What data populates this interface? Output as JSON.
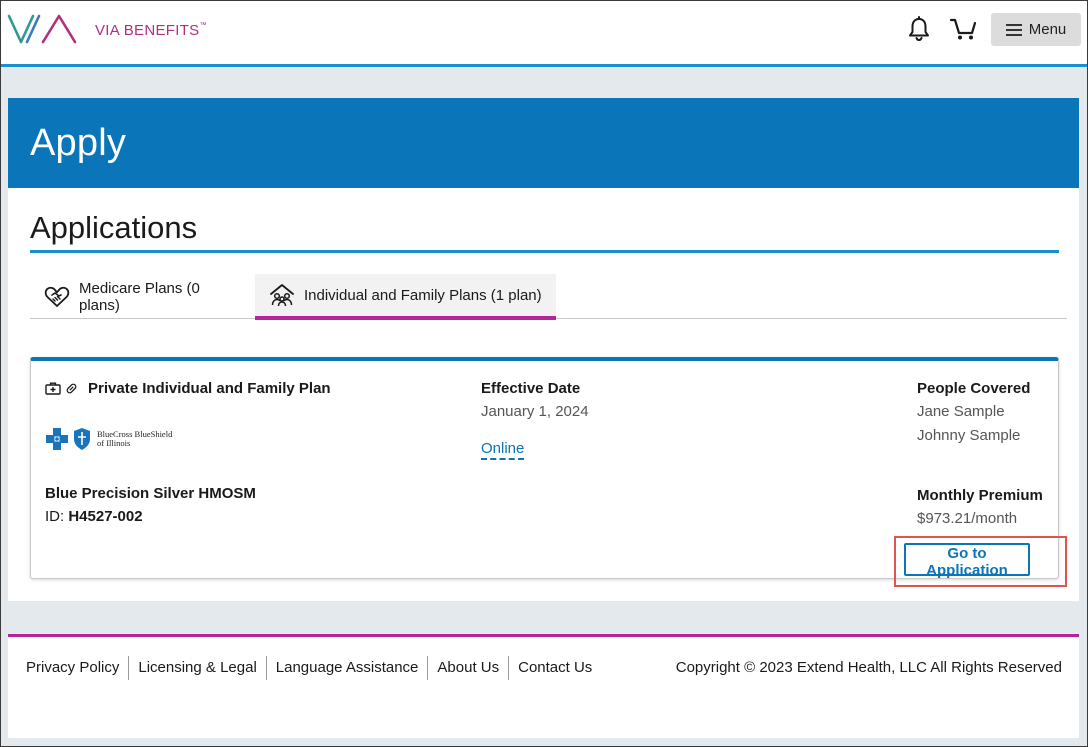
{
  "brand": {
    "name": "VIA BENEFITS",
    "tm": "™",
    "color_primary": "#b0307f",
    "color_secondary": "#2d9b8f"
  },
  "header": {
    "menu_label": "Menu",
    "icons": [
      "bell-icon",
      "cart-icon",
      "hamburger-icon"
    ]
  },
  "banner": {
    "title": "Apply",
    "color": "#0a75b8"
  },
  "section": {
    "title": "Applications"
  },
  "tabs": [
    {
      "label": "Medicare Plans (0 plans)",
      "icon": "handshake-heart-icon",
      "active": false
    },
    {
      "label": "Individual and Family Plans (1 plan)",
      "icon": "family-house-icon",
      "active": true
    }
  ],
  "card": {
    "plan_type": "Private Individual and Family Plan",
    "carrier_line1": "BlueCross BlueShield",
    "carrier_line2": "of Illinois",
    "plan_name": "Blue Precision Silver HMOSM",
    "id_label": "ID:",
    "id_value": "H4527-002",
    "effective_label": "Effective Date",
    "effective_value": "January 1, 2024",
    "online_link": "Online",
    "people_label": "People Covered",
    "people": [
      "Jane Sample",
      "Johnny Sample"
    ],
    "premium_label": "Monthly Premium",
    "premium_value": "$973.21/month",
    "button_label": "Go to Application"
  },
  "footer": {
    "links": [
      "Privacy Policy",
      "Licensing & Legal",
      "Language Assistance",
      "About Us",
      "Contact Us"
    ],
    "copyright": "Copyright © 2023 Extend Health, LLC All Rights Reserved"
  }
}
